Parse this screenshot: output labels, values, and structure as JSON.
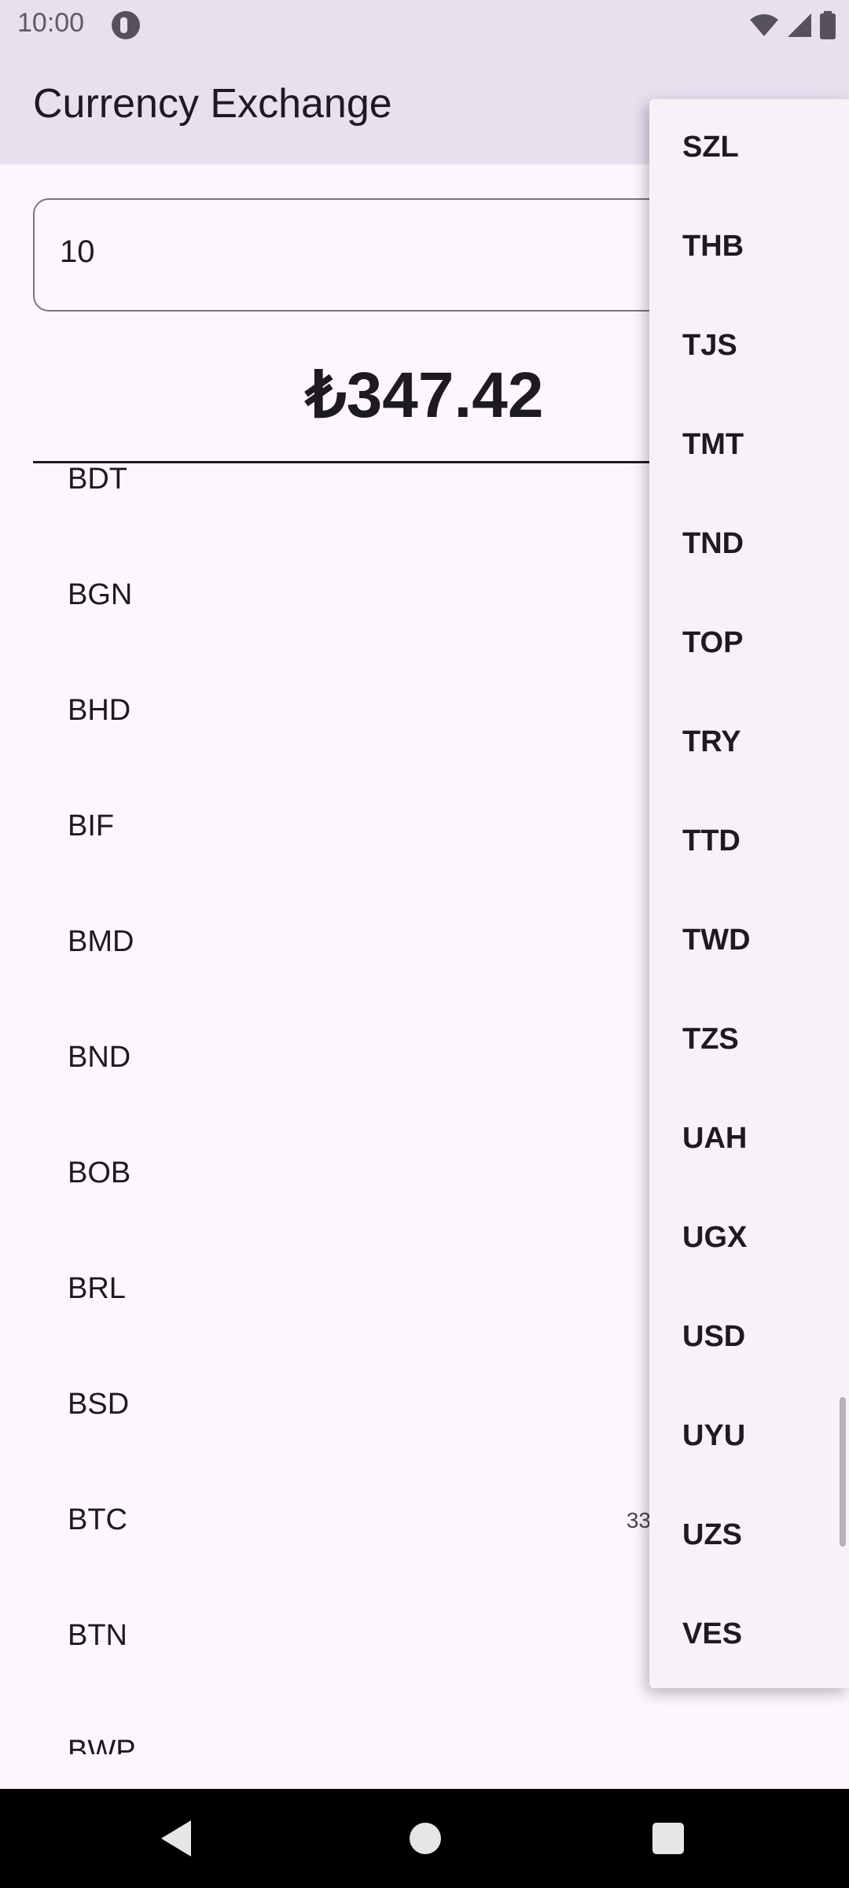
{
  "status_bar": {
    "time": "10:00",
    "icons": [
      "app-notification-icon",
      "wifi-icon",
      "signal-icon",
      "battery-icon"
    ]
  },
  "app_bar": {
    "title": "Currency Exchange"
  },
  "amount_input": {
    "value": "10"
  },
  "result": {
    "value": "₺347.42"
  },
  "currency_list": {
    "items": [
      {
        "code": "BDT",
        "value": ""
      },
      {
        "code": "BGN",
        "value": ""
      },
      {
        "code": "BHD",
        "value": ""
      },
      {
        "code": "BIF",
        "value": ""
      },
      {
        "code": "BMD",
        "value": ""
      },
      {
        "code": "BND",
        "value": ""
      },
      {
        "code": "BOB",
        "value": ""
      },
      {
        "code": "BRL",
        "value": ""
      },
      {
        "code": "BSD",
        "value": ""
      },
      {
        "code": "BTC",
        "value": "33"
      },
      {
        "code": "BTN",
        "value": ""
      },
      {
        "code": "BWP",
        "value": ""
      }
    ]
  },
  "dropdown": {
    "items": [
      "SZL",
      "THB",
      "TJS",
      "TMT",
      "TND",
      "TOP",
      "TRY",
      "TTD",
      "TWD",
      "TZS",
      "UAH",
      "UGX",
      "USD",
      "UYU",
      "UZS",
      "VES"
    ]
  },
  "nav_bar": {
    "icons": [
      "back-icon",
      "home-icon",
      "recents-icon"
    ]
  },
  "colors": {
    "app_bar_bg": "#e8e0ef",
    "page_bg": "#fdf7fd",
    "menu_bg": "#f8f1f8",
    "text": "#1d1b20",
    "outline": "#79747e"
  }
}
